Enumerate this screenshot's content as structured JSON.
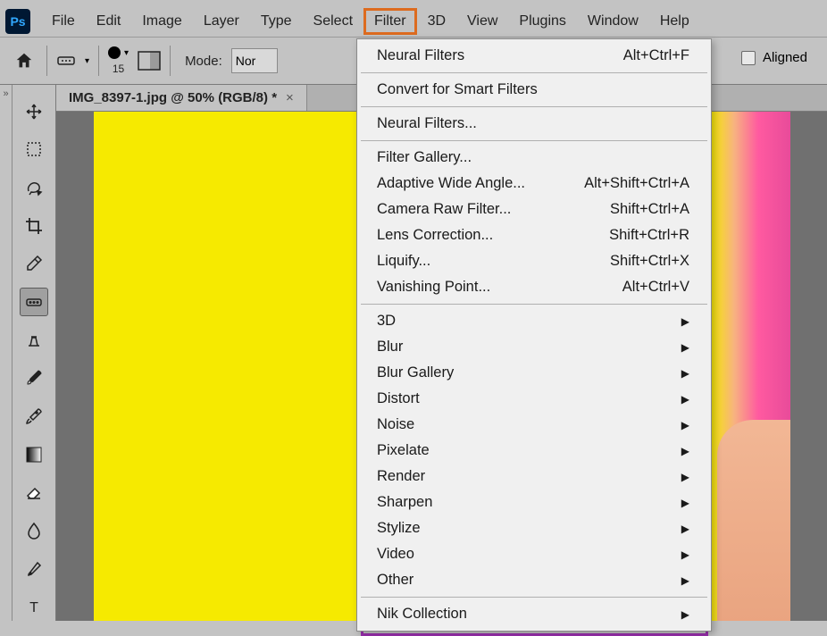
{
  "menubar": {
    "items": [
      "File",
      "Edit",
      "Image",
      "Layer",
      "Type",
      "Select",
      "Filter",
      "3D",
      "View",
      "Plugins",
      "Window",
      "Help"
    ],
    "active_index": 6
  },
  "options_bar": {
    "brush_size": "15",
    "mode_label": "Mode:",
    "mode_value": "Nor",
    "aligned_label": "Aligned"
  },
  "document": {
    "tab_title": "IMG_8397-1.jpg @ 50% (RGB/8) *"
  },
  "dropdown": {
    "groups": [
      [
        {
          "label": "Neural Filters",
          "shortcut": "Alt+Ctrl+F",
          "sub": false
        }
      ],
      [
        {
          "label": "Convert for Smart Filters",
          "shortcut": "",
          "sub": false
        }
      ],
      [
        {
          "label": "Neural Filters...",
          "shortcut": "",
          "sub": false
        }
      ],
      [
        {
          "label": "Filter Gallery...",
          "shortcut": "",
          "sub": false
        },
        {
          "label": "Adaptive Wide Angle...",
          "shortcut": "Alt+Shift+Ctrl+A",
          "sub": false
        },
        {
          "label": "Camera Raw Filter...",
          "shortcut": "Shift+Ctrl+A",
          "sub": false
        },
        {
          "label": "Lens Correction...",
          "shortcut": "Shift+Ctrl+R",
          "sub": false
        },
        {
          "label": "Liquify...",
          "shortcut": "Shift+Ctrl+X",
          "sub": false
        },
        {
          "label": "Vanishing Point...",
          "shortcut": "Alt+Ctrl+V",
          "sub": false
        }
      ],
      [
        {
          "label": "3D",
          "shortcut": "",
          "sub": true
        },
        {
          "label": "Blur",
          "shortcut": "",
          "sub": true
        },
        {
          "label": "Blur Gallery",
          "shortcut": "",
          "sub": true
        },
        {
          "label": "Distort",
          "shortcut": "",
          "sub": true
        },
        {
          "label": "Noise",
          "shortcut": "",
          "sub": true
        },
        {
          "label": "Pixelate",
          "shortcut": "",
          "sub": true
        },
        {
          "label": "Render",
          "shortcut": "",
          "sub": true
        },
        {
          "label": "Sharpen",
          "shortcut": "",
          "sub": true
        },
        {
          "label": "Stylize",
          "shortcut": "",
          "sub": true
        },
        {
          "label": "Video",
          "shortcut": "",
          "sub": true
        },
        {
          "label": "Other",
          "shortcut": "",
          "sub": true
        }
      ],
      [
        {
          "label": "Nik Collection",
          "shortcut": "",
          "sub": true
        }
      ]
    ]
  },
  "tools": [
    "move-tool",
    "marquee-tool",
    "lasso-tool",
    "crop-tool",
    "eyedropper-tool",
    "healing-brush-tool",
    "clone-stamp-tool",
    "brush-tool",
    "history-brush-tool",
    "gradient-tool",
    "eraser-tool",
    "blur-tool",
    "pen-tool",
    "type-tool"
  ],
  "selected_tool_index": 5,
  "collapse_glyph": "»"
}
